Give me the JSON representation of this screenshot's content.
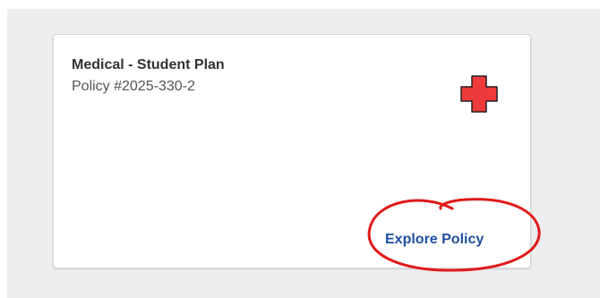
{
  "card": {
    "title": "Medical - Student Plan",
    "policy": "Policy #2025-330-2",
    "action_label": "Explore Policy",
    "icon": "medical-cross-icon"
  },
  "colors": {
    "background": "#eeeeee",
    "card": "#ffffff",
    "cross": "#ee3a3a",
    "link": "#1f4fa3",
    "annotation": "#e11a1a"
  }
}
